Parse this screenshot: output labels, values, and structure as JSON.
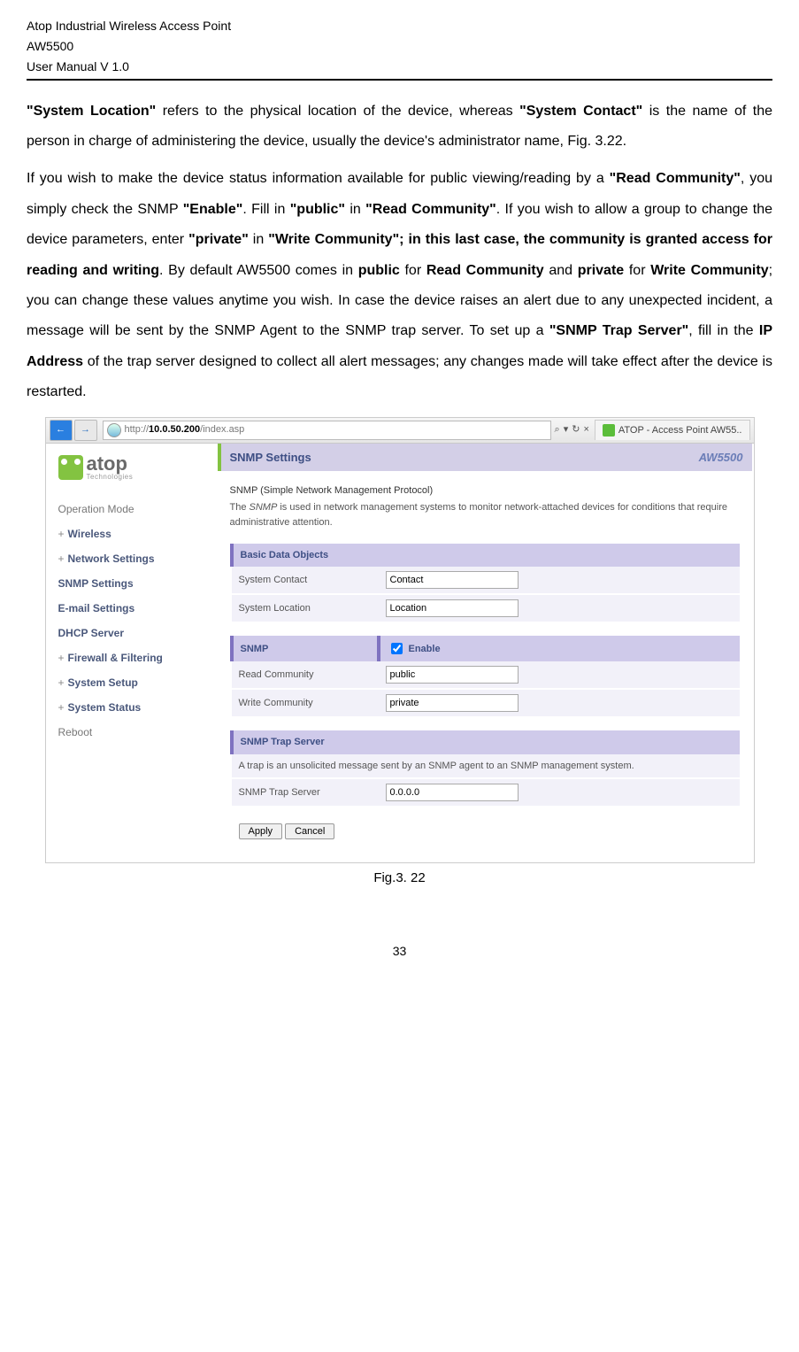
{
  "header": {
    "line1": "Atop Industrial Wireless Access Point",
    "line2": "AW5500",
    "line3": "User Manual V 1.0"
  },
  "para1": {
    "t1": "\"System Location\"",
    "t2": " refers to the physical location of the device, whereas ",
    "t3": "\"System Contact\"",
    "t4": " is the name of the person in charge of administering the device, usually the device's administrator name, Fig. 3.22."
  },
  "para2": {
    "t1": "If you wish to make the device status information available for public viewing/reading by a ",
    "t2": "\"Read Community\"",
    "t3": ", you simply check the SNMP ",
    "t4": "\"Enable\"",
    "t5": ". Fill in ",
    "t6": "\"public\"",
    "t7": " in ",
    "t8": "\"Read Community\"",
    "t9": ". If you wish to allow a group to change the device parameters, enter ",
    "t10": "\"private\"",
    "t11": " in ",
    "t12": "\"Write Community\"; in this last case, the community is granted access for reading and writing",
    "t13": ". By default AW5500 comes in ",
    "t14": "public",
    "t15": " for ",
    "t16": "Read Community",
    "t17": " and ",
    "t18": "private",
    "t19": " for ",
    "t20": "Write Community",
    "t21": "; you can change these values anytime you wish. In case the device raises an alert due to any unexpected incident, a message will be sent by the SNMP Agent to the SNMP trap server. To set up a ",
    "t22": "\"SNMP Trap Server\"",
    "t23": ", fill in the ",
    "t24": "IP Address",
    "t25": " of the trap server designed to collect all alert messages; any changes made will take effect after the device is restarted."
  },
  "browser": {
    "url_prefix": "http://",
    "url_host": "10.0.50.200",
    "url_path": "/index.asp",
    "search_hint": "",
    "tab_title": "ATOP - Access Point AW55.."
  },
  "logo": {
    "brand": "atop",
    "sub": "Technologies"
  },
  "nav": {
    "i0": "Operation Mode",
    "i1": "Wireless",
    "i2": "Network Settings",
    "i3": "SNMP Settings",
    "i4": "E-mail Settings",
    "i5": "DHCP Server",
    "i6": "Firewall & Filtering",
    "i7": "System Setup",
    "i8": "System Status",
    "i9": "Reboot"
  },
  "panel": {
    "title": "SNMP Settings",
    "model": "AW5500"
  },
  "desc": {
    "title": "SNMP (Simple Network Management Protocol)",
    "body_a": "The ",
    "body_i": "SNMP",
    "body_b": " is used in network management systems to monitor network-attached devices for conditions that require administrative attention."
  },
  "tbl1": {
    "head": "Basic Data Objects",
    "r1": "System Contact",
    "v1": "Contact",
    "r2": "System Location",
    "v2": "Location"
  },
  "tbl2": {
    "head": "SNMP",
    "enable": "Enable",
    "r1": "Read Community",
    "v1": "public",
    "r2": "Write Community",
    "v2": "private"
  },
  "tbl3": {
    "head": "SNMP Trap Server",
    "note": "A trap is an unsolicited message sent by an SNMP agent to an SNMP management system.",
    "r1": "SNMP Trap Server",
    "v1": "0.0.0.0"
  },
  "buttons": {
    "apply": "Apply",
    "cancel": "Cancel"
  },
  "caption": "Fig.3. 22",
  "page_num": "33",
  "glyphs": {
    "mag": "⌕",
    "refresh": "↻",
    "close": "×",
    "dropdown": "▾",
    "chrome_sep": "·"
  }
}
